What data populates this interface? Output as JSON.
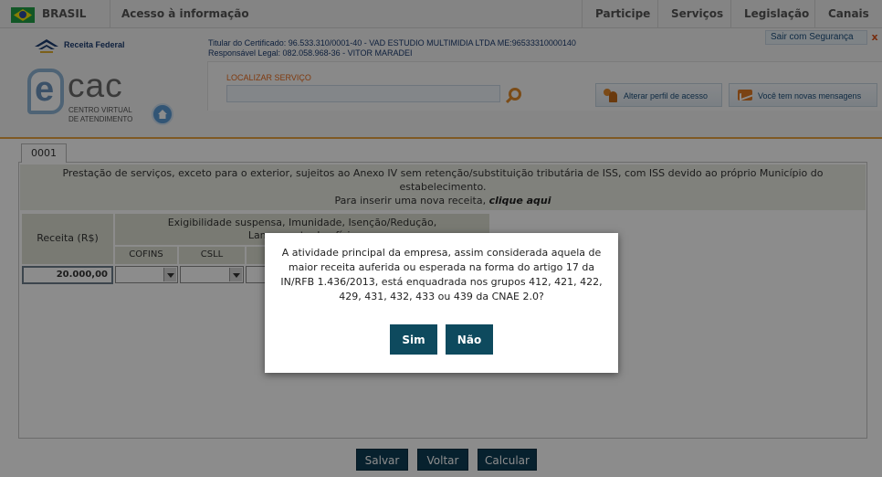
{
  "govbar": {
    "country": "BRASIL",
    "access_info": "Acesso à informação",
    "nav": [
      "Participe",
      "Serviços",
      "Legislação",
      "Canais"
    ]
  },
  "header": {
    "rf_name": "Receita Federal",
    "cert_line1": "Titular do Certificado: 96.533.310/0001-40 - VAD ESTUDIO MULTIMIDIA LTDA ME:96533310000140",
    "cert_line2": "Responsável Legal: 082.058.968-36 - VITOR MARADEI",
    "logout": "Sair com Segurança",
    "logout_close": "x",
    "ecac_letter": "e",
    "ecac_rest": "cac",
    "ecac_sub1": "CENTRO VIRTUAL",
    "ecac_sub2": "DE ATENDIMENTO",
    "search_label": "LOCALIZAR SERVIÇO",
    "search_value": "",
    "profile_button": "Alterar perfil de acesso",
    "messages_button": "Você tem novas mensagens"
  },
  "content": {
    "tab": "0001",
    "description": "Prestação de serviços, exceto para o exterior, sujeitos ao Anexo IV sem retenção/substituição tributária de ISS, com ISS devido ao próprio Município do estabelecimento.",
    "insert_prefix": "Para inserir uma nova receita, ",
    "insert_link": "clique aqui",
    "col_receita": "Receita (R$)",
    "col_group_line1": "Exigibilidade suspensa, Imunidade, Isenção/Redução,",
    "col_group_line2": "Lançamento de ofício",
    "col_cofins": "COFINS",
    "col_csll": "CSLL",
    "receita_value": "20.000,00"
  },
  "buttons": {
    "save": "Salvar",
    "back": "Voltar",
    "calc": "Calcular"
  },
  "modal": {
    "question": "A atividade principal da empresa, assim considerada aquela de maior receita auferida ou esperada na forma do artigo 17 da IN/RFB 1.436/2013, está enquadrada nos grupos 412, 421, 422, 429, 431, 432, 433 ou 439 da CNAE 2.0?",
    "yes": "Sim",
    "no": "Não"
  },
  "colors": {
    "accent": "#e8a243",
    "button": "#0d3c55",
    "modal_button": "#0e4a5e"
  }
}
